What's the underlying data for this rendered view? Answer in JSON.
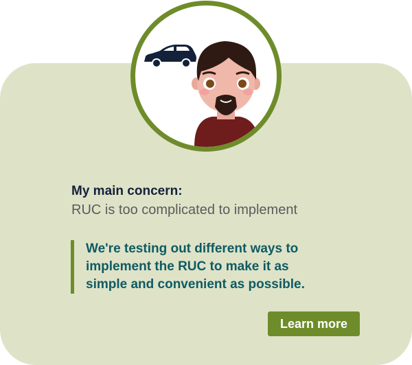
{
  "avatar": {
    "icons": [
      "car-icon",
      "person-illustration"
    ]
  },
  "concern": {
    "heading": "My main concern:",
    "text": "RUC is too complicated to implement"
  },
  "response": {
    "lines": [
      "We're testing out different ways to",
      "implement the RUC to make it as",
      "simple and convenient as possible."
    ]
  },
  "button": {
    "label": "Learn more"
  },
  "colors": {
    "card_background": "#dee3c8",
    "accent_green": "#6e8c2a",
    "response_teal": "#0f5a63",
    "heading_navy": "#14213a"
  }
}
